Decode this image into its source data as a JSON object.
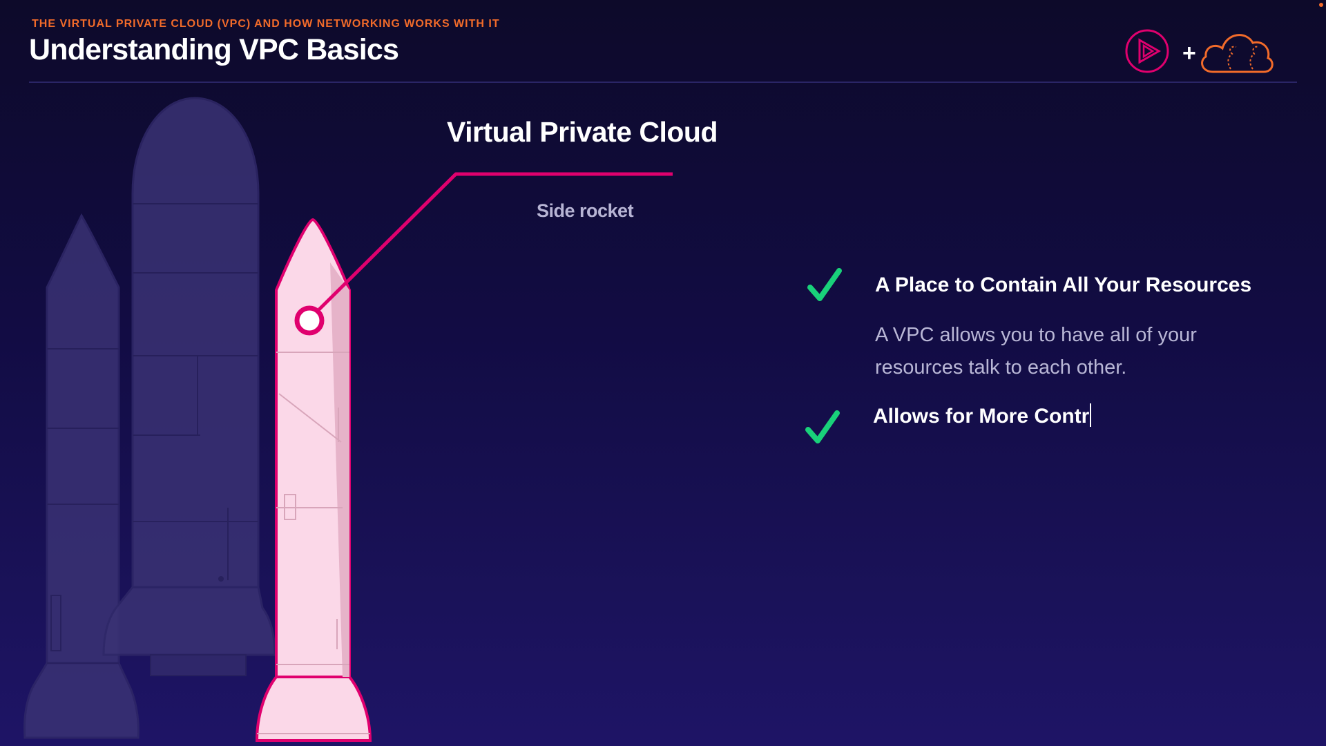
{
  "header": {
    "eyebrow": "THE VIRTUAL PRIVATE CLOUD (VPC) AND HOW NETWORKING WORKS WITH IT",
    "title": "Understanding VPC Basics",
    "logos": {
      "left_icon": "play-icon",
      "separator": "+",
      "right_icon": "cloud-icon"
    }
  },
  "diagram": {
    "title": "Virtual Private Cloud",
    "subtitle": "Side rocket"
  },
  "points": [
    {
      "title": "A Place to Contain All Your Resources",
      "description": "A VPC allows you to have all of your resources talk to each other.",
      "icon": "checkmark-icon"
    },
    {
      "title": "Allows for More Contr",
      "icon": "checkmark-icon"
    }
  ],
  "colors": {
    "background": "#120c44",
    "accent_orange": "#f26b2a",
    "accent_pink": "#e0006e",
    "check_green": "#19d17a",
    "rocket_highlight": "#fbd8e8",
    "rocket_muted": "#3a3274"
  }
}
